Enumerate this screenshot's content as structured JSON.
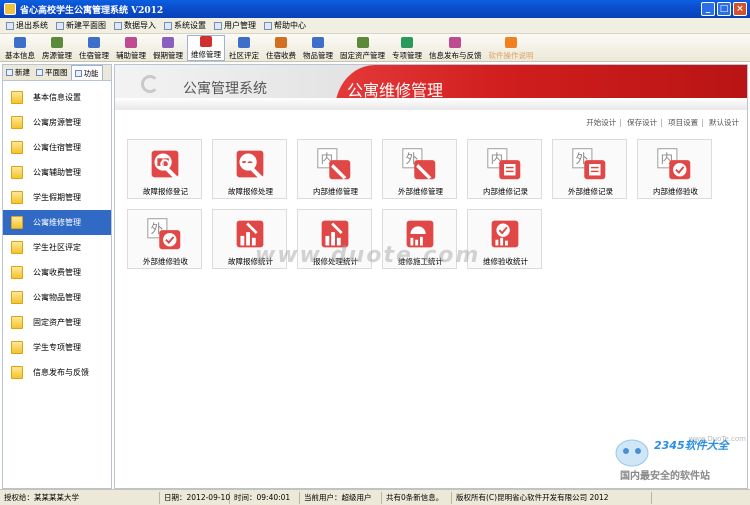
{
  "window": {
    "title": "省心高校学生公寓管理系统  V2012"
  },
  "menu": [
    {
      "label": "退出系统"
    },
    {
      "label": "新建平面图"
    },
    {
      "label": "数据导入"
    },
    {
      "label": "系统设置"
    },
    {
      "label": "用户管理"
    },
    {
      "label": "帮助中心"
    }
  ],
  "toolbar": [
    {
      "label": "基本信息",
      "color": "#3d6ec9"
    },
    {
      "label": "房源管理",
      "color": "#5a8a3a"
    },
    {
      "label": "住宿管理",
      "color": "#3d6ec9"
    },
    {
      "label": "辅助管理",
      "color": "#c04a8f"
    },
    {
      "label": "假期管理",
      "color": "#8a5fc0"
    },
    {
      "label": "维修管理",
      "color": "#d03030",
      "active": true
    },
    {
      "label": "社区评定",
      "color": "#3d6ec9"
    },
    {
      "label": "住宿收费",
      "color": "#d07020"
    },
    {
      "label": "物品管理",
      "color": "#3d6ec9"
    },
    {
      "label": "固定资产管理",
      "color": "#5a8a3a"
    },
    {
      "label": "专项管理",
      "color": "#2a9a5a"
    },
    {
      "label": "信息发布与反馈",
      "color": "#c04a8f"
    },
    {
      "label": "软件操作说明",
      "color": "#f08020",
      "dim": true
    }
  ],
  "left_tabs": [
    {
      "label": "新建"
    },
    {
      "label": "平面图"
    },
    {
      "label": "功能",
      "on": true
    }
  ],
  "left_items": [
    {
      "label": "基本信息设置"
    },
    {
      "label": "公寓房源管理"
    },
    {
      "label": "公寓住宿管理"
    },
    {
      "label": "公寓辅助管理"
    },
    {
      "label": "学生假期管理"
    },
    {
      "label": "公寓维修管理",
      "selected": true
    },
    {
      "label": "学生社区评定"
    },
    {
      "label": "公寓收费管理"
    },
    {
      "label": "公寓物品管理"
    },
    {
      "label": "固定资产管理"
    },
    {
      "label": "学生专项管理"
    },
    {
      "label": "信息发布与反馈"
    }
  ],
  "banner": {
    "system_title": "公寓管理系统",
    "module_title": "公寓维修管理"
  },
  "links": [
    "开始设计",
    "保存设计",
    "项目设置",
    "默认设计"
  ],
  "tiles": [
    {
      "label": "故障报修登记",
      "glyph": "book-wrench"
    },
    {
      "label": "故障报修处理",
      "glyph": "circle-minus-wrench"
    },
    {
      "label": "内部维修管理",
      "glyph": "内"
    },
    {
      "label": "外部维修管理",
      "glyph": "外"
    },
    {
      "label": "内部维修记录",
      "glyph": "内-doc"
    },
    {
      "label": "外部维修记录",
      "glyph": "外-doc"
    },
    {
      "label": "内部维修验收",
      "glyph": "内-check"
    },
    {
      "label": "外部维修验收",
      "glyph": "外-check"
    },
    {
      "label": "故障报修统计",
      "glyph": "chart-wrench"
    },
    {
      "label": "报修处理统计",
      "glyph": "chart-wrench"
    },
    {
      "label": "维修施工统计",
      "glyph": "dome-chart"
    },
    {
      "label": "维修验收统计",
      "glyph": "check-chart"
    }
  ],
  "watermark": "www.duote.com",
  "brand": {
    "name": "2345软件大全",
    "slogan": "国内最安全的软件站",
    "url": "www.DuoTe.com"
  },
  "status": [
    "授权给：某某某某大学",
    "日期：2012-09-10",
    "时间：09:40:01",
    "当前用户：超级用户",
    "共有0条新信息。",
    "版权所有(C)昆明省心软件开发有限公司 2012"
  ],
  "colors": {
    "accent_red": "#d11e1e",
    "selection_blue": "#316ac5",
    "titlebar_blue": "#0b4fcf"
  }
}
